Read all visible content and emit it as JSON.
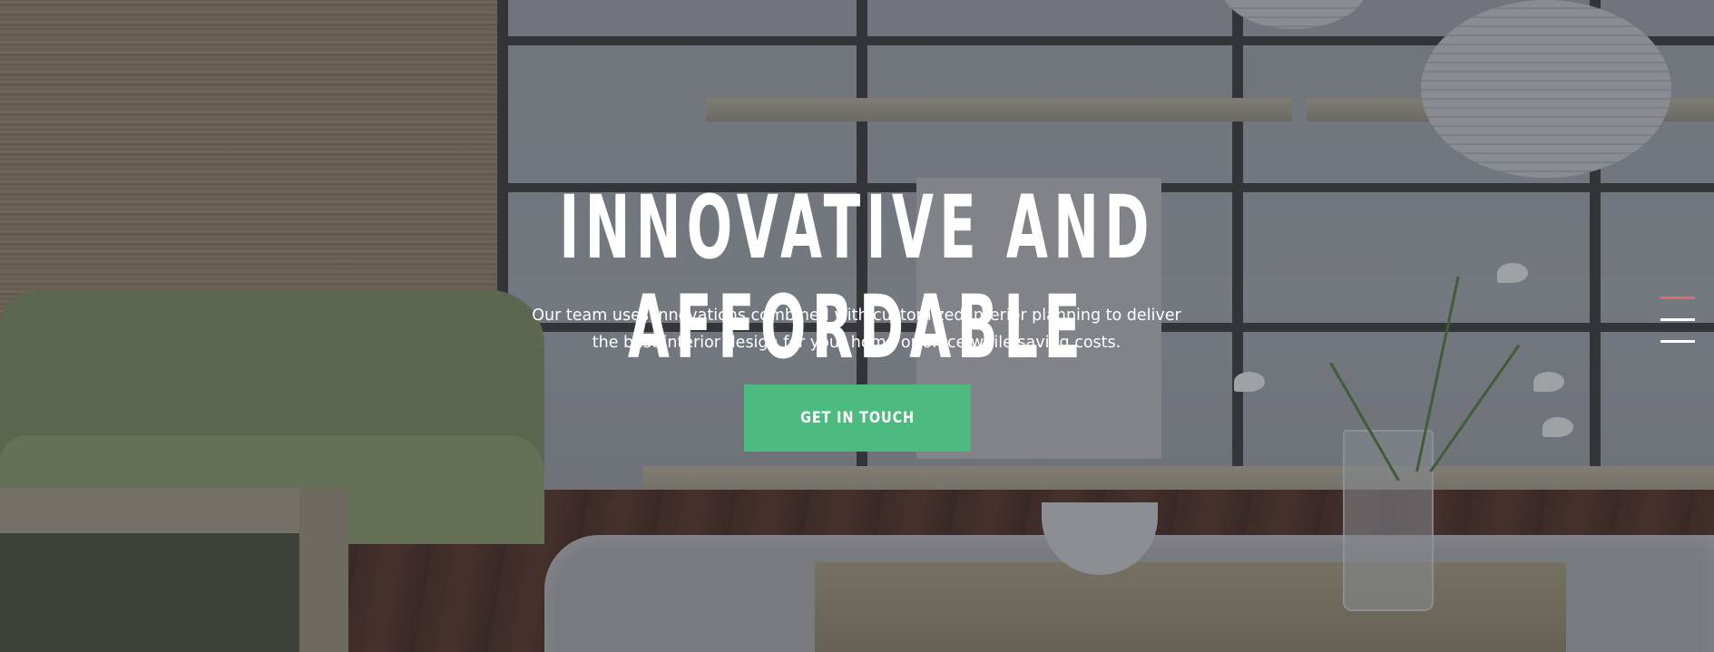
{
  "hero": {
    "title": "INNOVATIVE AND AFFORDABLE",
    "description_line1": "Our team uses innovations combined with customized interior planning to deliver",
    "description_line2": "the best interior design for your home or office while saving costs.",
    "cta_label": "GET IN TOUCH"
  },
  "colors": {
    "accent": "#4dbb7f",
    "menu_active_bar": "#e0696b",
    "text": "#ffffff"
  },
  "icons": {
    "menu": "hamburger-menu-icon"
  }
}
